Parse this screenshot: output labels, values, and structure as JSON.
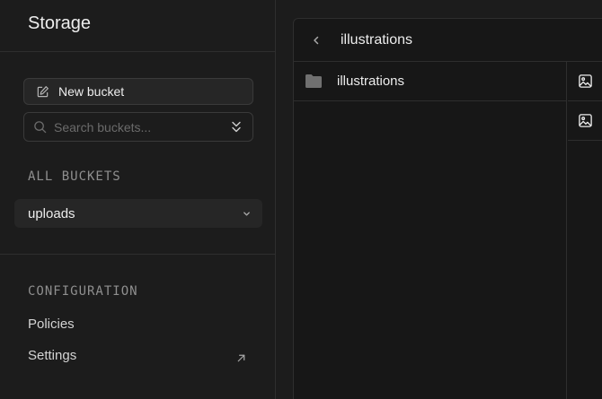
{
  "sidebar": {
    "title": "Storage",
    "new_bucket_label": "New bucket",
    "search": {
      "placeholder": "Search buckets...",
      "value": ""
    },
    "all_buckets_label": "ALL BUCKETS",
    "buckets": [
      {
        "label": "uploads",
        "icon": "chevron-down-icon"
      }
    ],
    "configuration_label": "CONFIGURATION",
    "config_items": [
      {
        "label": "Policies"
      },
      {
        "label": "Settings",
        "icon": "external-link-icon"
      }
    ]
  },
  "explorer": {
    "header_title": "illustrations",
    "folders": [
      {
        "label": "illustrations",
        "icon": "folder-icon"
      }
    ],
    "files": [
      {
        "icon": "image-icon"
      },
      {
        "icon": "image-icon"
      }
    ]
  },
  "colors": {
    "background": "#1c1c1c",
    "panel": "#171717",
    "border": "#2e2e2e",
    "text": "#ededed",
    "muted": "#8f8f8f"
  }
}
